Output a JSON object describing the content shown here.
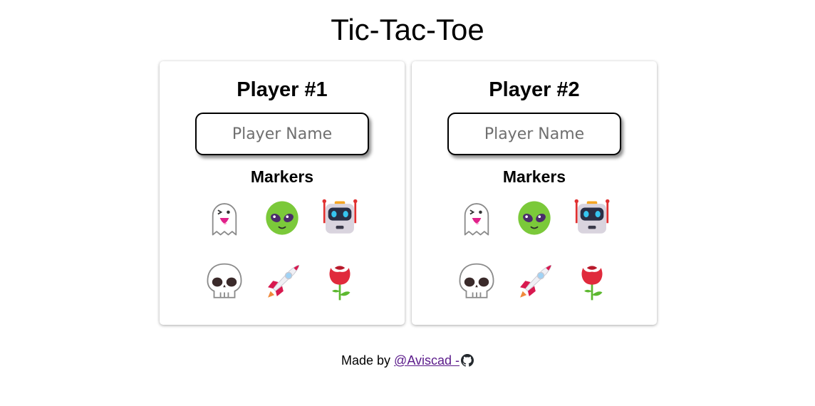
{
  "page": {
    "title": "Tic-Tac-Toe"
  },
  "players": [
    {
      "heading": "Player #1",
      "name_placeholder": "Player Name",
      "name_value": "",
      "markers_heading": "Markers"
    },
    {
      "heading": "Player #2",
      "name_placeholder": "Player Name",
      "name_value": "",
      "markers_heading": "Markers"
    }
  ],
  "markers": [
    {
      "name": "ghost-icon"
    },
    {
      "name": "alien-icon"
    },
    {
      "name": "robot-icon"
    },
    {
      "name": "skull-icon"
    },
    {
      "name": "rocket-icon"
    },
    {
      "name": "rose-icon"
    }
  ],
  "footer": {
    "prefix": "Made by",
    "link_text": "@Aviscad -",
    "icon": "github-icon"
  },
  "colors": {
    "link": "#5a1a8a",
    "alien": "#7bc93a",
    "rose": "#e02a3c",
    "rocket": "#d8194f"
  }
}
